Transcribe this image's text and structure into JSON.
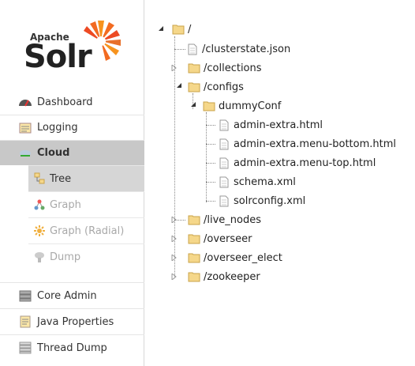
{
  "logo": {
    "apache": "Apache",
    "solr": "Solr"
  },
  "nav": {
    "dashboard": "Dashboard",
    "logging": "Logging",
    "cloud": "Cloud",
    "tree": "Tree",
    "graph": "Graph",
    "graph_radial": "Graph (Radial)",
    "dump": "Dump",
    "core_admin": "Core Admin",
    "java_properties": "Java Properties",
    "thread_dump": "Thread Dump"
  },
  "tree": {
    "root": "/",
    "clusterstate": "/clusterstate.json",
    "collections": "/collections",
    "configs": "/configs",
    "dummyconf": "dummyConf",
    "files": [
      "admin-extra.html",
      "admin-extra.menu-bottom.html",
      "admin-extra.menu-top.html",
      "schema.xml",
      "solrconfig.xml"
    ],
    "live_nodes": "/live_nodes",
    "overseer": "/overseer",
    "overseer_elect": "/overseer_elect",
    "zookeeper": "/zookeeper"
  },
  "colors": {
    "active_nav": "#c8c8c8",
    "folder": "#f5d78a",
    "solr_orange": "#e8702a"
  }
}
